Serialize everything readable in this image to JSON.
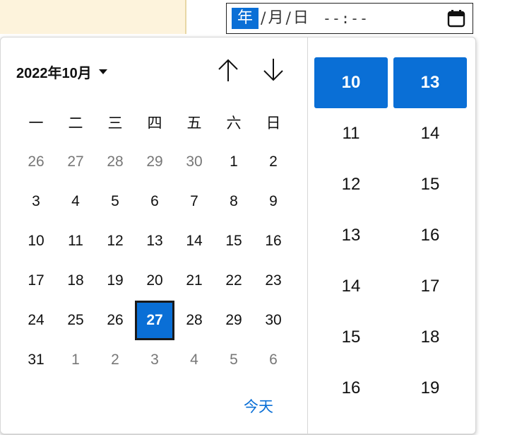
{
  "input": {
    "year_seg": "年",
    "sep1": "/",
    "month_seg": "月",
    "sep2": "/",
    "day_seg": "日",
    "time_seg": "--:--"
  },
  "calendar": {
    "month_label": "2022年10月",
    "weekdays": [
      "一",
      "二",
      "三",
      "四",
      "五",
      "六",
      "日"
    ],
    "weeks": [
      [
        "26",
        "27",
        "28",
        "29",
        "30",
        "1",
        "2"
      ],
      [
        "3",
        "4",
        "5",
        "6",
        "7",
        "8",
        "9"
      ],
      [
        "10",
        "11",
        "12",
        "13",
        "14",
        "15",
        "16"
      ],
      [
        "17",
        "18",
        "19",
        "20",
        "21",
        "22",
        "23"
      ],
      [
        "24",
        "25",
        "26",
        "27",
        "28",
        "29",
        "30"
      ],
      [
        "31",
        "1",
        "2",
        "3",
        "4",
        "5",
        "6"
      ]
    ],
    "selected_day": "27",
    "today_label": "今天"
  },
  "time": {
    "hours": [
      "10",
      "11",
      "12",
      "13",
      "14",
      "15",
      "16"
    ],
    "minutes": [
      "13",
      "14",
      "15",
      "16",
      "17",
      "18",
      "19"
    ],
    "selected_hour": "10",
    "selected_minute": "13"
  },
  "colors": {
    "accent": "#0a6fd6",
    "muted_day": "#777777"
  }
}
